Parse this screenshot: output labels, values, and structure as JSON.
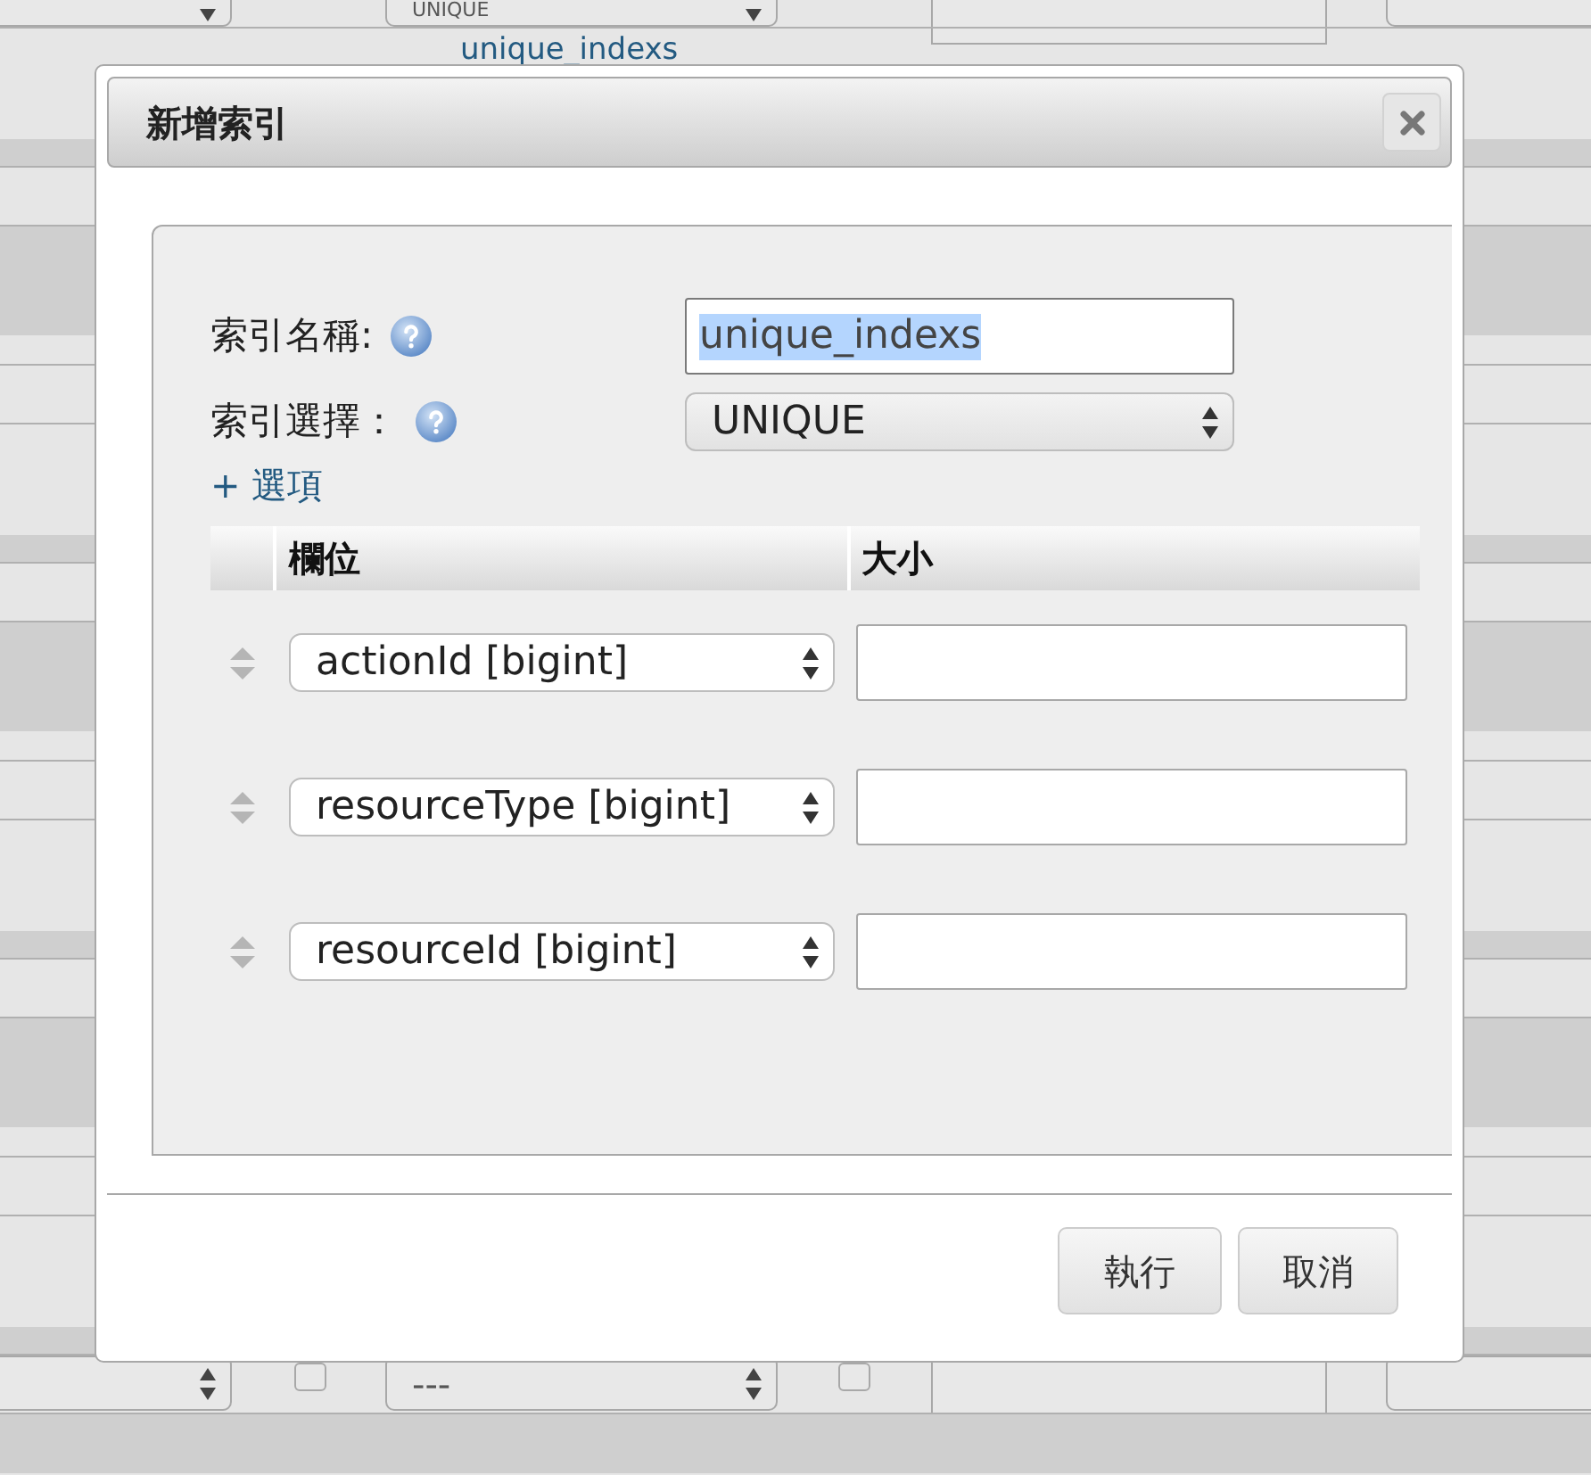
{
  "background_table": {
    "rows": [
      {
        "index_type": "UNIQUE",
        "link": "unique_indexs"
      },
      {
        "index_type": "---",
        "checkboxes": [
          {
            "checked": false
          },
          {
            "checked": false
          }
        ]
      }
    ]
  },
  "dialog": {
    "title": "新增索引",
    "fields": [
      {
        "kind": "input",
        "label": "索引名稱:",
        "value": "unique_indexs",
        "value_selected": true
      },
      {
        "kind": "select",
        "label": "索引選擇：",
        "value": "UNIQUE"
      }
    ],
    "add_option_link": "+ 選項",
    "columns_table": {
      "columns": [
        "欄位",
        "大小"
      ],
      "rows": [
        {
          "column": "actionId [bigint]"
        },
        {
          "column": "resourceType [bigint]"
        },
        {
          "column": "resourceId [bigint]"
        }
      ]
    },
    "buttons": [
      "執行",
      "取消"
    ]
  }
}
